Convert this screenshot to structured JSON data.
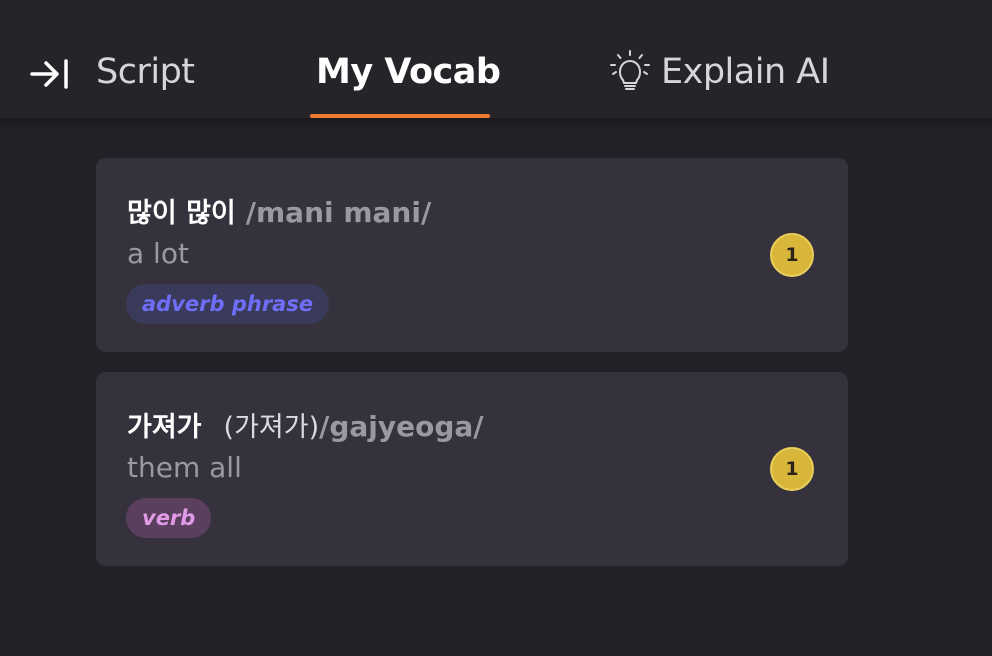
{
  "tabs": {
    "script_label": "Script",
    "vocab_label": "My Vocab",
    "explain_label": "Explain AI",
    "active": "My Vocab",
    "accent_color": "#f07a30"
  },
  "icons": {
    "collapse": "arrow-right-to-bar-icon",
    "explain": "lightbulb-icon"
  },
  "vocab": [
    {
      "word": "많이 많이",
      "hanja": "",
      "romanization": "/mani mani/",
      "meaning": "a lot",
      "pos": "adverb phrase",
      "count": "1"
    },
    {
      "word": "가져가",
      "hanja": "(가져가)",
      "romanization": "/gajyeoga/",
      "meaning": "them all",
      "pos": "verb",
      "count": "1"
    }
  ]
}
